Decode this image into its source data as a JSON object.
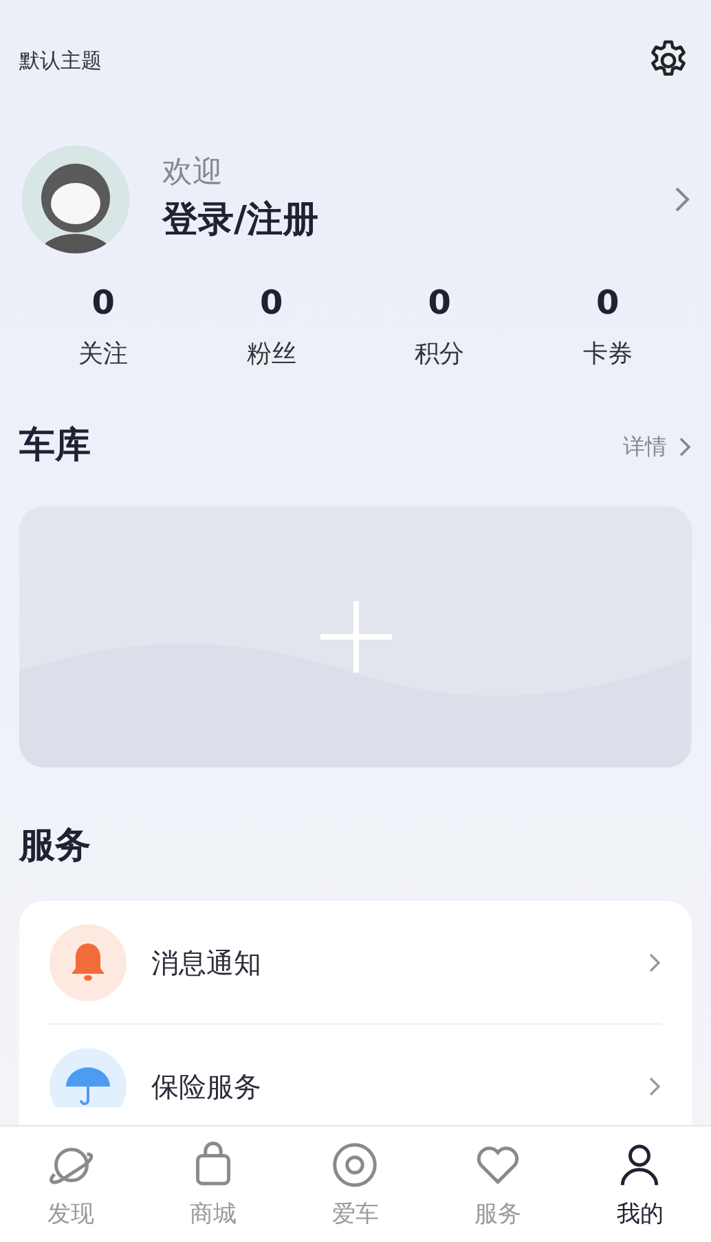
{
  "header": {
    "theme_label": "默认主题"
  },
  "profile": {
    "greeting": "欢迎",
    "login": "登录/注册"
  },
  "stats": [
    {
      "value": "0",
      "label": "关注"
    },
    {
      "value": "0",
      "label": "粉丝"
    },
    {
      "value": "0",
      "label": "积分"
    },
    {
      "value": "0",
      "label": "卡券"
    }
  ],
  "garage": {
    "title": "车库",
    "details": "详情"
  },
  "services": {
    "title": "服务",
    "items": [
      {
        "kind": "bell",
        "label": "消息通知"
      },
      {
        "kind": "umbrella",
        "label": "保险服务"
      }
    ]
  },
  "tab_bar": [
    {
      "kind": "planet",
      "label": "发现",
      "selected": false
    },
    {
      "kind": "bag",
      "label": "商城",
      "selected": false
    },
    {
      "kind": "target",
      "label": "爱车",
      "selected": false
    },
    {
      "kind": "heart",
      "label": "服务",
      "selected": false
    },
    {
      "kind": "person",
      "label": "我的",
      "selected": true
    }
  ]
}
